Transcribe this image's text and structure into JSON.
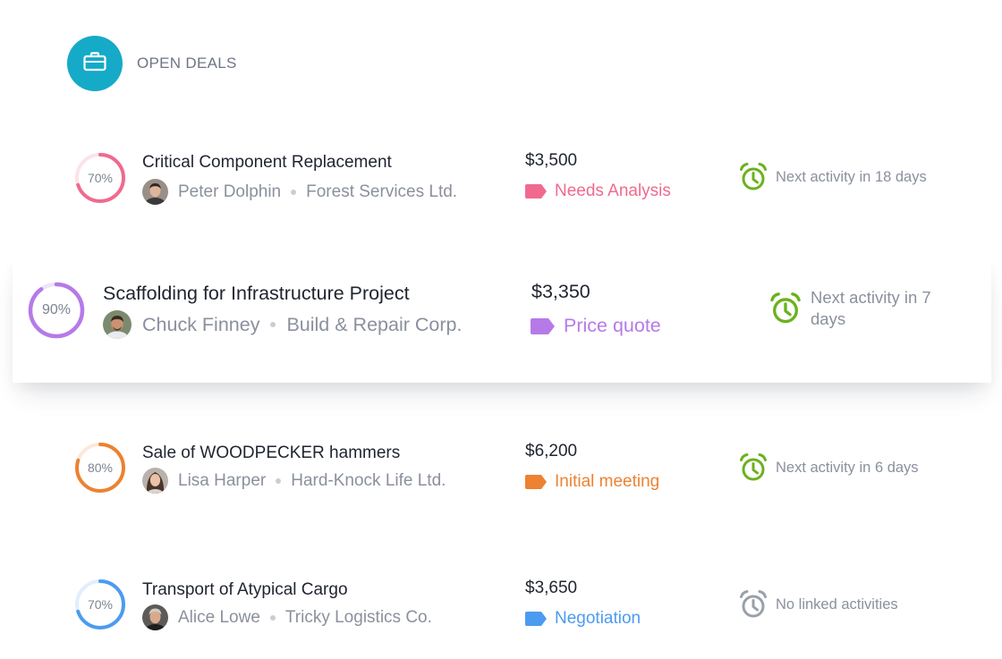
{
  "header": {
    "title": "OPEN DEALS",
    "icon": "briefcase-icon",
    "icon_bg": "#15aac8"
  },
  "deals": [
    {
      "progress": 0.7,
      "progress_label": "70%",
      "ring_color": "#f06a8f",
      "title": "Critical Component Replacement",
      "contact": "Peter Dolphin",
      "company": "Forest Services Ltd.",
      "amount": "$3,500",
      "stage": "Needs Analysis",
      "stage_color": "#f06a8f",
      "activity": "Next activity in 18 days",
      "activity_color": "#6bb21e",
      "highlighted": false
    },
    {
      "progress": 0.9,
      "progress_label": "90%",
      "ring_color": "#b67ae8",
      "title": "Scaffolding for Infrastructure Project",
      "contact": "Chuck Finney",
      "company": "Build & Repair Corp.",
      "amount": "$3,350",
      "stage": "Price quote",
      "stage_color": "#b67ae8",
      "activity": "Next activity in 7 days",
      "activity_color": "#6bb21e",
      "highlighted": true
    },
    {
      "progress": 0.8,
      "progress_label": "80%",
      "ring_color": "#ec8232",
      "title": "Sale of WOODPECKER hammers",
      "contact": "Lisa Harper",
      "company": "Hard-Knock Life Ltd.",
      "amount": "$6,200",
      "stage": "Initial meeting",
      "stage_color": "#ec8232",
      "activity": "Next activity in 6 days",
      "activity_color": "#6bb21e",
      "highlighted": false
    },
    {
      "progress": 0.7,
      "progress_label": "70%",
      "ring_color": "#4c9bf0",
      "title": "Transport of Atypical Cargo",
      "contact": "Alice Lowe",
      "company": "Tricky Logistics Co.",
      "amount": "$3,650",
      "stage": "Negotiation",
      "stage_color": "#4c9bf0",
      "activity": "No linked activities",
      "activity_color": "#9aa0aa",
      "highlighted": false
    }
  ]
}
